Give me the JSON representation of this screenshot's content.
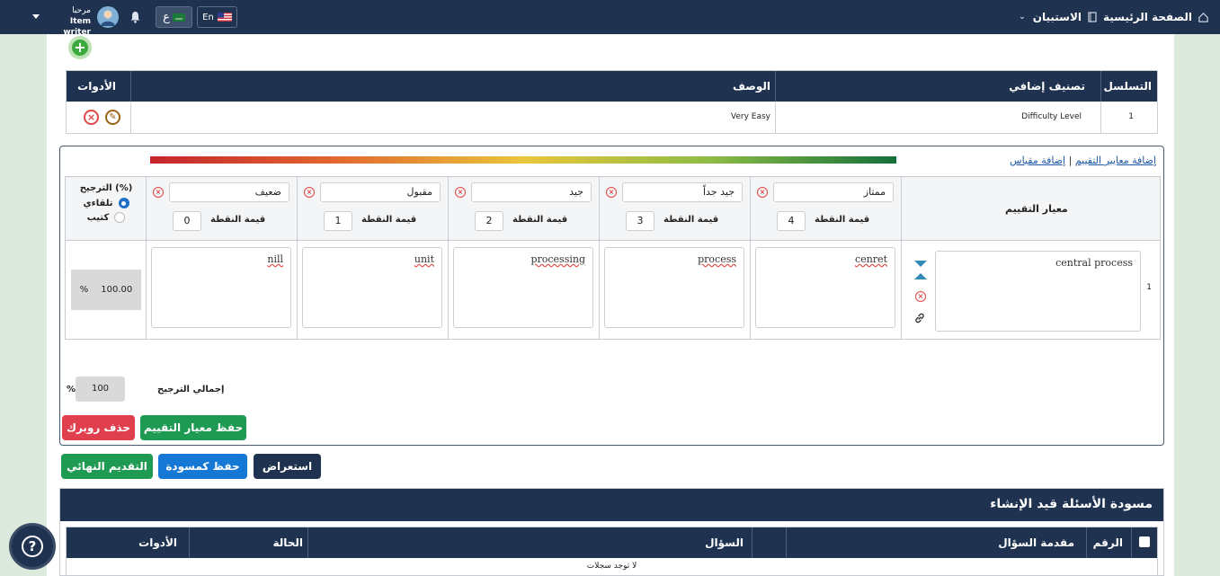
{
  "topbar": {
    "home": "الصفحة الرئيسية",
    "surveys": "الاستبيان",
    "lang_en": "En",
    "lang_ar": "ع",
    "greeting": "مرحبا",
    "user_role": "Item writer"
  },
  "classification_table": {
    "headers": {
      "seq": "التسلسل",
      "extra": "تصنيف إضافي",
      "desc": "الوصف",
      "tools": "الأدوات"
    },
    "rows": [
      {
        "seq": "1",
        "extra": "Difficulty Level",
        "desc": "Very Easy"
      }
    ]
  },
  "rubric": {
    "link_add_criteria": "إضافة معايير التقييم",
    "link_sep": "|",
    "link_add_scale": "إضافة مقياس",
    "criteria_header": "معيار التقييم",
    "weight_header": "(%) الترجيح",
    "weight_auto": "تلقاءي",
    "weight_manual": "كتيب",
    "points_label": "قيمة النقطة",
    "levels": [
      {
        "name": "ممتاز",
        "points": "4",
        "answer": "cenret"
      },
      {
        "name": "جيد جداً",
        "points": "3",
        "answer": "process"
      },
      {
        "name": "جيد",
        "points": "2",
        "answer": "processing"
      },
      {
        "name": "مقبول",
        "points": "1",
        "answer": "unit"
      },
      {
        "name": "ضعيف",
        "points": "0",
        "answer": "nill"
      }
    ],
    "criteria_row": {
      "num": "1",
      "text": "central process",
      "weight": "100.00",
      "pct": "%"
    },
    "total_label": "إجمالي الترجيح",
    "total_value": "100",
    "total_pct": "%",
    "save_button": "حفظ معيار التقييم",
    "delete_button": "حذف روبرك"
  },
  "actions": {
    "preview": "استعراض",
    "draft": "حفظ كمسودة",
    "final": "التقديم النهائي"
  },
  "drafts": {
    "title": "مسودة الأسئلة قيد الإنشاء",
    "headers": {
      "num": "الرقم",
      "intro": "مقدمة السؤال",
      "question": "السؤال",
      "status": "الحالة",
      "tools": "الأدوات"
    },
    "empty": "لا توجد سجلات"
  },
  "colors": {
    "navy": "#1f3350",
    "green": "#1e9a52",
    "red": "#e0404e",
    "blue": "#1478d4"
  }
}
